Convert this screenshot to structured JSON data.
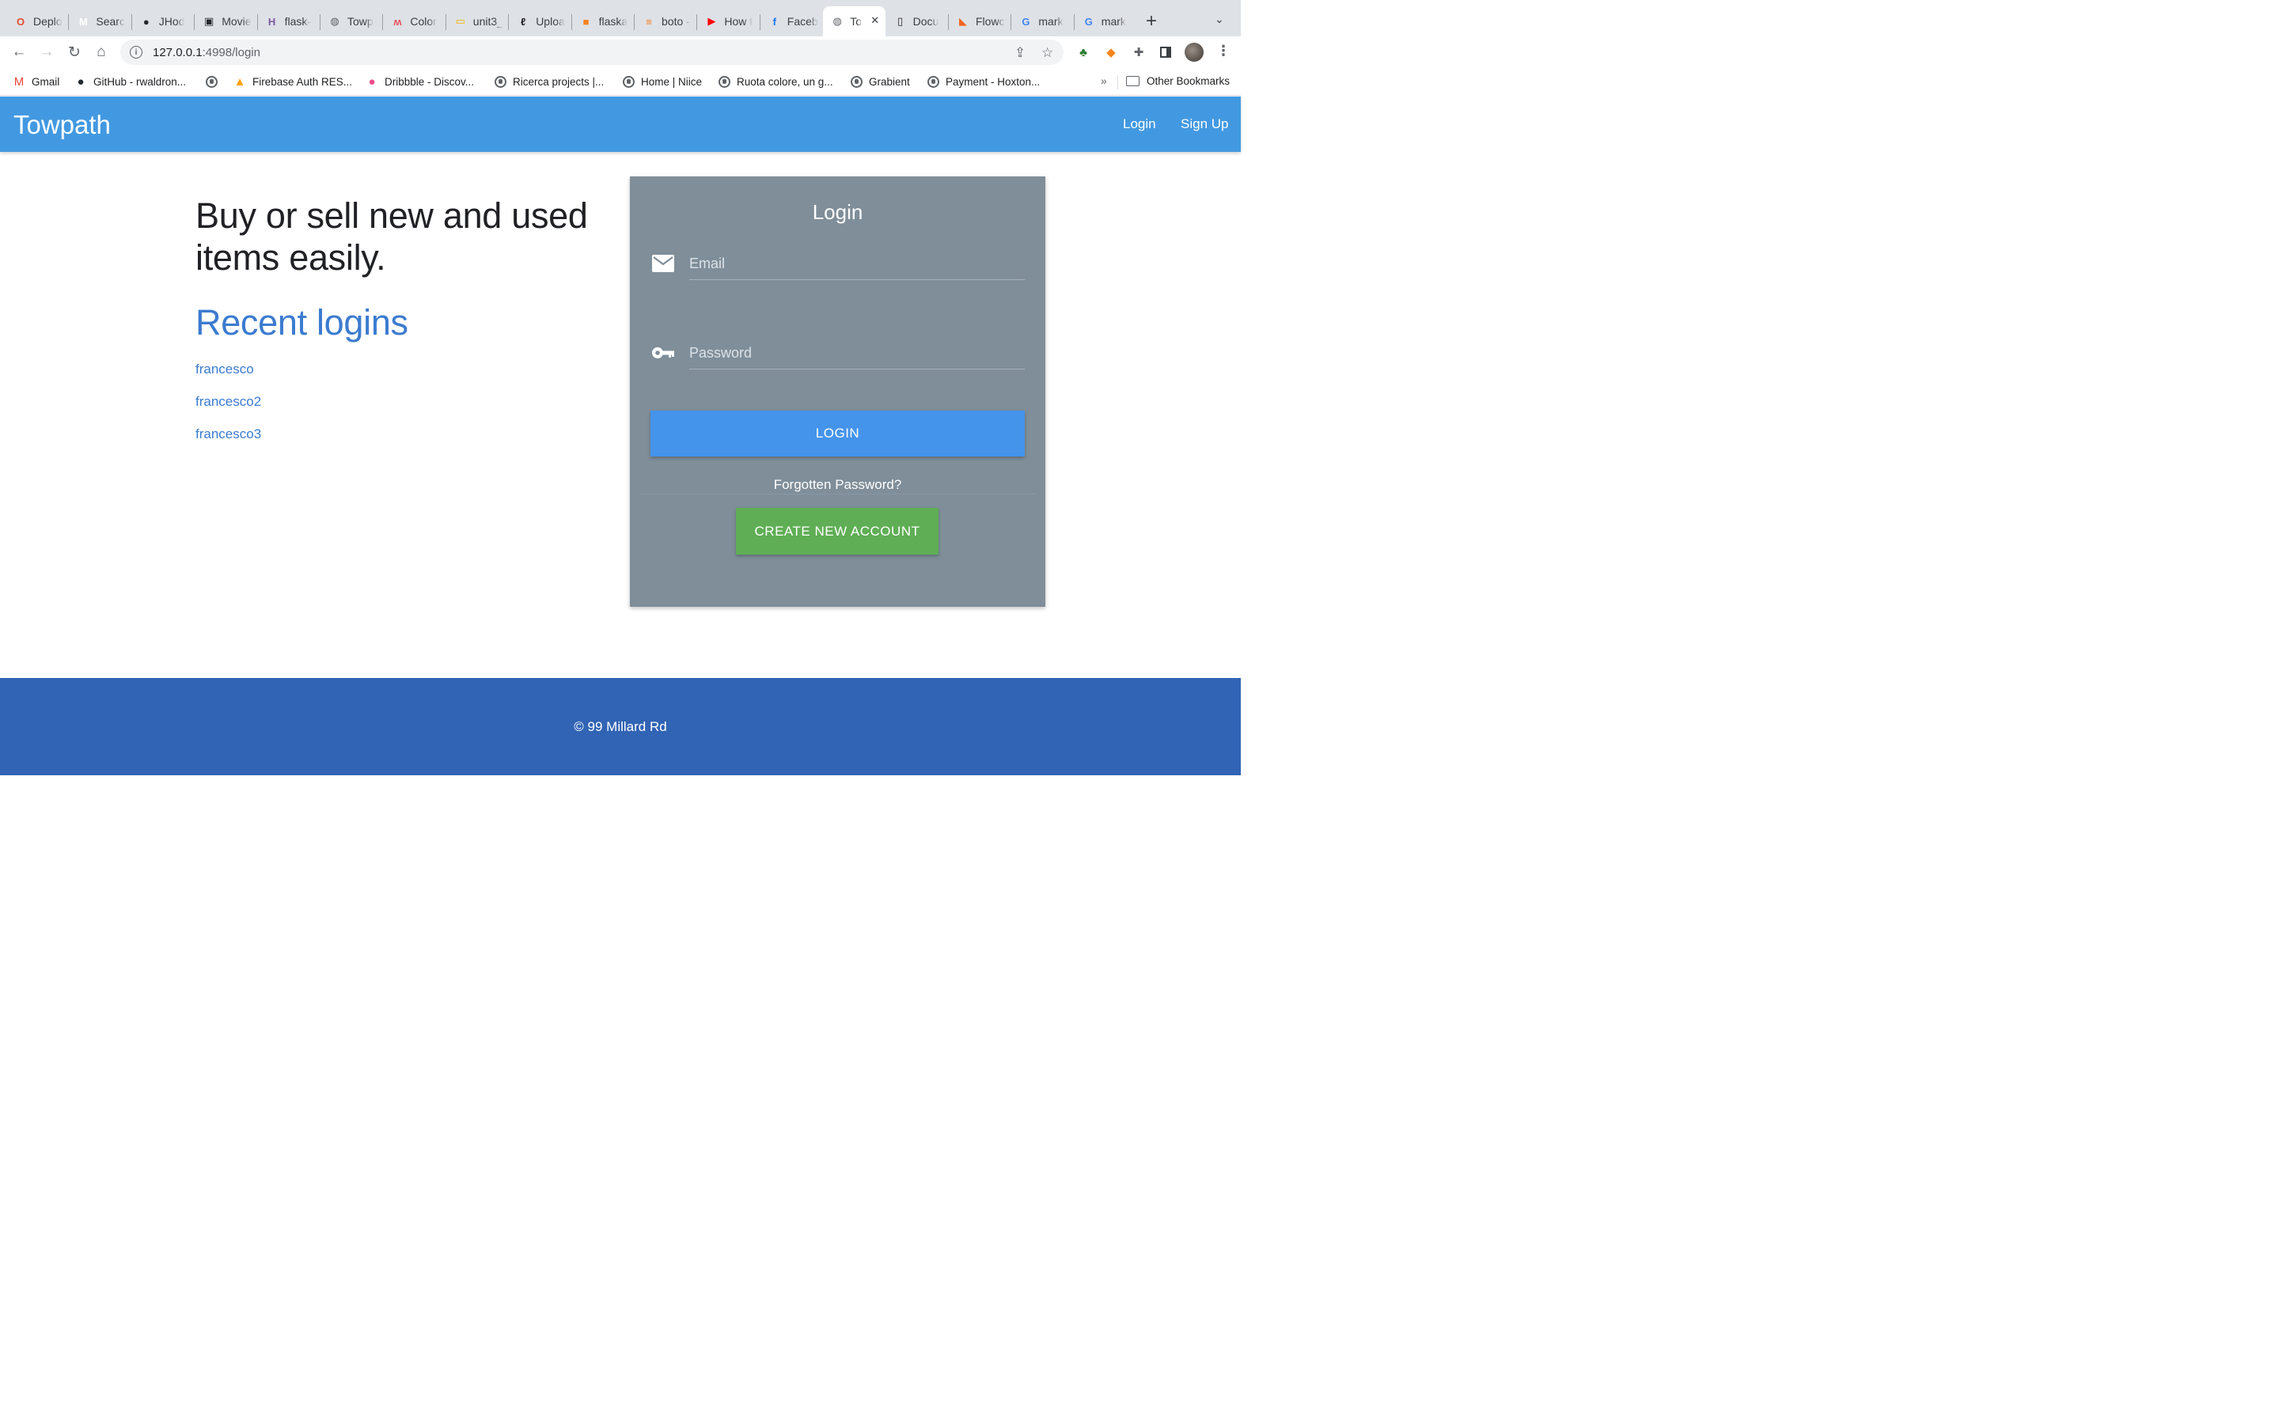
{
  "browser": {
    "tabs": [
      {
        "title": "Deplo",
        "icon": "opera-icon",
        "color": "#e6492d"
      },
      {
        "title": "Searc",
        "icon": "gmail-icon",
        "color": "#ffffff"
      },
      {
        "title": "JHod",
        "icon": "github-icon",
        "color": "#24292e"
      },
      {
        "title": "Movie",
        "icon": "film-icon",
        "color": "#24292e"
      },
      {
        "title": "flask-",
        "icon": "heroku-icon",
        "color": "#79589f"
      },
      {
        "title": "Towp",
        "icon": "globe-icon",
        "color": "#5f6368"
      },
      {
        "title": "Color",
        "icon": "color-wheel-icon",
        "color": "#e8505b"
      },
      {
        "title": "unit3_",
        "icon": "bookmark-icon",
        "color": "#f4b400"
      },
      {
        "title": "Uploa",
        "icon": "leaf-icon",
        "color": "#202124"
      },
      {
        "title": "flaska",
        "icon": "box-icon",
        "color": "#f5821f"
      },
      {
        "title": "boto -",
        "icon": "stackoverflow-icon",
        "color": "#f48024"
      },
      {
        "title": "How t",
        "icon": "youtube-icon",
        "color": "#ff0000"
      },
      {
        "title": "Faceb",
        "icon": "facebook-icon",
        "color": "#1877f2"
      },
      {
        "title": "To",
        "icon": "globe-icon",
        "color": "#5f6368"
      },
      {
        "title": "Docu",
        "icon": "document-icon",
        "color": "#202124"
      },
      {
        "title": "Flowc",
        "icon": "flowcode-icon",
        "color": "#f26522"
      },
      {
        "title": "mark",
        "icon": "google-icon",
        "color": "#4285f4"
      },
      {
        "title": "mark",
        "icon": "google-icon",
        "color": "#4285f4"
      }
    ],
    "active_tab_index": 13,
    "url_host": "127.0.0.1",
    "url_rest": ":4998/login",
    "bookmarks": [
      {
        "label": "Gmail",
        "icon": "gmail-icon"
      },
      {
        "label": "GitHub - rwaldron...",
        "icon": "github-icon"
      },
      {
        "label": "",
        "icon": "globe-icon"
      },
      {
        "label": "Firebase Auth RES...",
        "icon": "firebase-icon"
      },
      {
        "label": "Dribbble - Discov...",
        "icon": "dribbble-icon"
      },
      {
        "label": "Ricerca projects |...",
        "icon": "globe-icon"
      },
      {
        "label": "Home | Niice",
        "icon": "globe-icon"
      },
      {
        "label": "Ruota colore, un g...",
        "icon": "globe-icon"
      },
      {
        "label": "Grabient",
        "icon": "globe-icon"
      },
      {
        "label": "Payment - Hoxton...",
        "icon": "globe-icon"
      }
    ],
    "more_bookmarks": "»",
    "other_bookmarks": "Other Bookmarks"
  },
  "navbar": {
    "brand": "Towpath",
    "login": "Login",
    "signup": "Sign Up",
    "color": "#4299e1"
  },
  "main": {
    "hero": "Buy or sell new and used items easily.",
    "recent_title": "Recent logins",
    "recent_logins": [
      "francesco",
      "francesco2",
      "francesco3"
    ]
  },
  "login_card": {
    "title": "Login",
    "email_placeholder": "Email",
    "email_value": "",
    "password_placeholder": "Password",
    "password_value": "",
    "login_button": "LOGIN",
    "forgot": "Forgotten Password?",
    "create_button": "CREATE NEW ACCOUNT",
    "card_color": "#7f8e99",
    "login_color": "#4494eb",
    "create_color": "#5fae55"
  },
  "footer": {
    "text": "© 99 Millard Rd",
    "color": "#3164b4"
  }
}
